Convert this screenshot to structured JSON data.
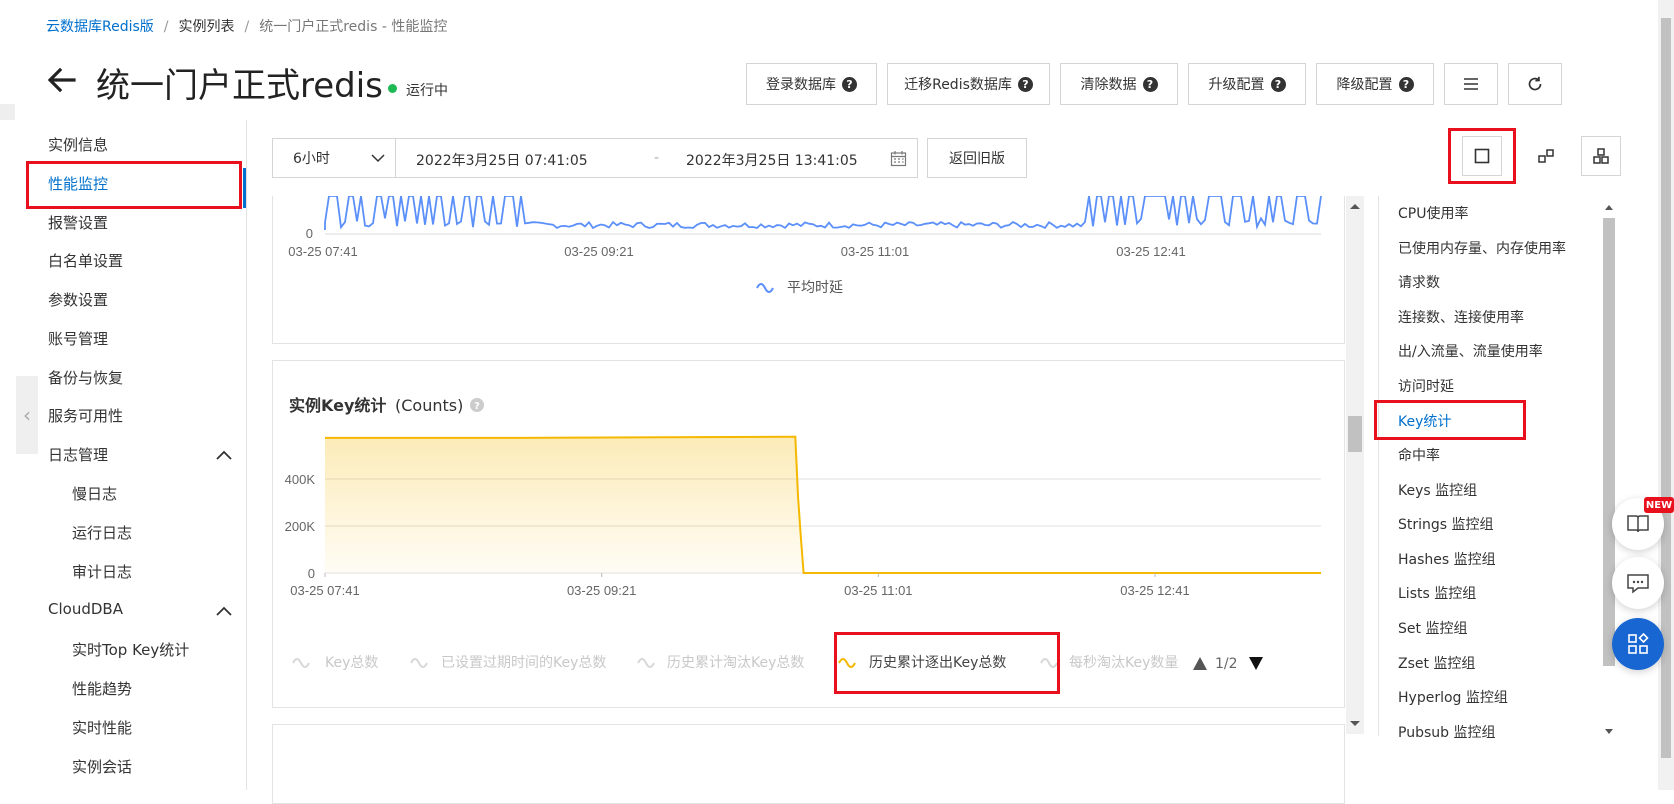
{
  "breadcrumb": {
    "items": [
      "云数据库Redis版",
      "实例列表",
      "统一门户正式redis - 性能监控"
    ],
    "separator": "/"
  },
  "header": {
    "title": "统一门户正式redis",
    "status": "运行中",
    "status_color": "#1db954",
    "buttons": [
      "登录数据库",
      "迁移Redis数据库",
      "清除数据",
      "升级配置",
      "降级配置"
    ],
    "menu_icon": "hamburger-icon",
    "refresh_icon": "refresh-icon"
  },
  "sidebar": {
    "items": [
      "实例信息",
      "性能监控",
      "报警设置",
      "白名单设置",
      "参数设置",
      "账号管理",
      "备份与恢复",
      "服务可用性",
      "日志管理",
      "慢日志",
      "运行日志",
      "审计日志",
      "CloudDBA",
      "实时Top Key统计",
      "性能趋势",
      "实时性能",
      "实例会话"
    ],
    "active": "性能监控"
  },
  "toolbar": {
    "range_select": "6小时",
    "start_time": "2022年3月25日 07:41:05",
    "date_separator": "-",
    "end_time": "2022年3月25日 13:41:05",
    "old_version_button": "返回旧版"
  },
  "latency_chart": {
    "y_tick_zero": "0",
    "x_ticks": [
      "03-25 07:41",
      "03-25 09:21",
      "03-25 11:01",
      "03-25 12:41"
    ],
    "legend": "平均时延",
    "series_color": "#5b8ff9"
  },
  "key_chart": {
    "title": "实例Key统计",
    "unit": "(Counts)",
    "legend_items": [
      "Key总数",
      "已设置过期时间的Key总数",
      "历史累计淘汰Key总数",
      "历史累计逐出Key总数",
      "每秒淘汰Key数量"
    ],
    "legend_page": "1/2",
    "series_color": "#f5b800"
  },
  "chart_data": {
    "type": "area",
    "title": "实例Key统计 (Counts)",
    "x_ticks": [
      "03-25 07:41",
      "03-25 09:21",
      "03-25 11:01",
      "03-25 12:41"
    ],
    "y_ticks": [
      "0",
      "200K",
      "400K"
    ],
    "ylim": [
      0,
      600000
    ],
    "series": [
      {
        "name": "历史累计逐出Key总数",
        "x": [
          "03-25 07:41",
          "03-25 08:51",
          "03-25 10:30",
          "03-25 10:31",
          "03-25 10:32",
          "03-25 10:33",
          "03-25 10:34",
          "03-25 13:41"
        ],
        "values": [
          575000,
          575000,
          580000,
          580000,
          320000,
          150000,
          0,
          0
        ]
      }
    ],
    "grid": true,
    "legend_position": "bottom"
  },
  "right_nav": {
    "items": [
      "CPU使用率",
      "已使用内存量、内存使用率",
      "请求数",
      "连接数、连接使用率",
      "出/入流量、流量使用率",
      "访问时延",
      "Key统计",
      "命中率",
      "Keys 监控组",
      "Strings 监控组",
      "Hashes 监控组",
      "Lists 监控组",
      "Set 监控组",
      "Zset 监控组",
      "Hyperlog 监控组",
      "Pubsub 监控组"
    ],
    "active": "Key统计"
  },
  "floating": {
    "new_badge": "NEW"
  }
}
